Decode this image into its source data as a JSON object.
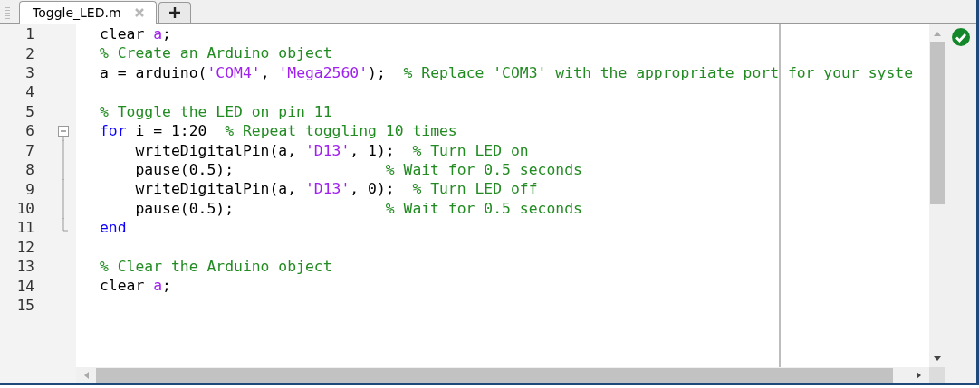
{
  "tabs": [
    {
      "label": "Toggle_LED.m",
      "selected": true
    }
  ],
  "editor": {
    "valid": true,
    "lines": [
      {
        "number": "1",
        "tokens": [
          {
            "kind": "plain",
            "text": "clear "
          },
          {
            "kind": "var",
            "text": "a"
          },
          {
            "kind": "plain",
            "text": ";"
          }
        ]
      },
      {
        "number": "2",
        "tokens": [
          {
            "kind": "comment",
            "text": "% Create an Arduino object"
          }
        ]
      },
      {
        "number": "3",
        "tokens": [
          {
            "kind": "plain",
            "text": "a = arduino("
          },
          {
            "kind": "string",
            "text": "'COM4'"
          },
          {
            "kind": "plain",
            "text": ", "
          },
          {
            "kind": "string",
            "text": "'Mega2560'"
          },
          {
            "kind": "plain",
            "text": ");  "
          },
          {
            "kind": "comment",
            "text": "% Replace 'COM3' with the appropriate port for your syste"
          }
        ]
      },
      {
        "number": "4"
      },
      {
        "number": "5",
        "tokens": [
          {
            "kind": "comment",
            "text": "% Toggle the LED on pin 11"
          }
        ]
      },
      {
        "number": "6",
        "expanded": true,
        "tokens": [
          {
            "kind": "keyword",
            "text": "for"
          },
          {
            "kind": "plain",
            "text": " i = 1:20  "
          },
          {
            "kind": "comment",
            "text": "% Repeat toggling 10 times"
          }
        ],
        "children": [
          {
            "number": "7",
            "tokens": [
              {
                "kind": "plain",
                "text": "    writeDigitalPin(a, "
              },
              {
                "kind": "string",
                "text": "'D13'"
              },
              {
                "kind": "plain",
                "text": ", 1);  "
              },
              {
                "kind": "comment",
                "text": "% Turn LED on"
              }
            ]
          },
          {
            "number": "8",
            "tokens": [
              {
                "kind": "plain",
                "text": "    pause(0.5);                 "
              },
              {
                "kind": "comment",
                "text": "% Wait for 0.5 seconds"
              }
            ]
          },
          {
            "number": "9",
            "tokens": [
              {
                "kind": "plain",
                "text": "    writeDigitalPin(a, "
              },
              {
                "kind": "string",
                "text": "'D13'"
              },
              {
                "kind": "plain",
                "text": ", 0);  "
              },
              {
                "kind": "comment",
                "text": "% Turn LED off"
              }
            ]
          },
          {
            "number": "10",
            "tokens": [
              {
                "kind": "plain",
                "text": "    pause(0.5);                 "
              },
              {
                "kind": "comment",
                "text": "% Wait for 0.5 seconds"
              }
            ]
          },
          {
            "number": "11",
            "tokens": [
              {
                "kind": "keyword",
                "text": "end"
              }
            ]
          }
        ]
      },
      {
        "number": "12"
      },
      {
        "number": "13",
        "tokens": [
          {
            "kind": "comment",
            "text": "% Clear the Arduino object"
          }
        ]
      },
      {
        "number": "14",
        "tokens": [
          {
            "kind": "plain",
            "text": "clear "
          },
          {
            "kind": "var",
            "text": "a"
          },
          {
            "kind": "plain",
            "text": ";"
          }
        ]
      },
      {
        "number": "15"
      }
    ]
  }
}
